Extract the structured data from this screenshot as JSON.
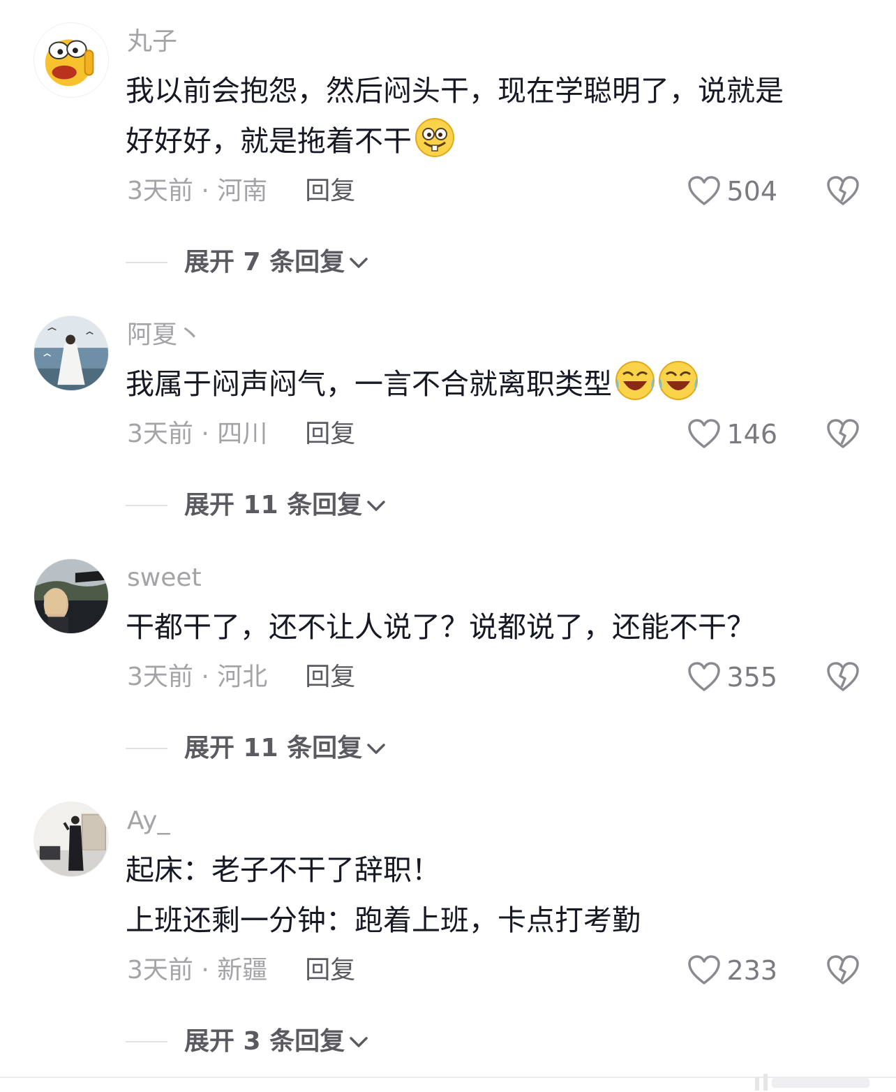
{
  "comments": [
    {
      "username": "丸子",
      "lines": [
        "我以前会抱怨，然后闷头干，现在学聪明了，说就是",
        "好好好，就是拖着不干"
      ],
      "meta": "3天前 · 河南",
      "reply_label": "回复",
      "likes": "504",
      "expand_label": "展开 7 条回复",
      "avatar_icon": "surprised-emoji-avatar",
      "trailing_emoji": "grin-emoji-icon"
    },
    {
      "username": "阿夏丶",
      "lines": [
        "我属于闷声闷气，一言不合就离职类型"
      ],
      "meta": "3天前 · 四川",
      "reply_label": "回复",
      "likes": "146",
      "expand_label": "展开 11 条回复",
      "avatar_icon": "seaside-photo-avatar",
      "trailing_emoji": "laugh-cry-emoji-icon"
    },
    {
      "username": "sweet",
      "lines": [
        "干都干了，还不让人说了？说都说了，还能不干？"
      ],
      "meta": "3天前 · 河北",
      "reply_label": "回复",
      "likes": "355",
      "expand_label": "展开 11 条回复",
      "avatar_icon": "car-selfie-avatar",
      "trailing_emoji": ""
    },
    {
      "username": "Ay_",
      "lines": [
        "起床：老子不干了辞职！",
        "上班还剩一分钟：跑着上班，卡点打考勤"
      ],
      "meta": "3天前 · 新疆",
      "reply_label": "回复",
      "likes": "233",
      "expand_label": "展开 3 条回复",
      "avatar_icon": "room-selfie-avatar",
      "trailing_emoji": ""
    }
  ],
  "colors": {
    "text": "#161823",
    "secondary": "#a3a3a8",
    "emphasis": "#5a5a60"
  }
}
